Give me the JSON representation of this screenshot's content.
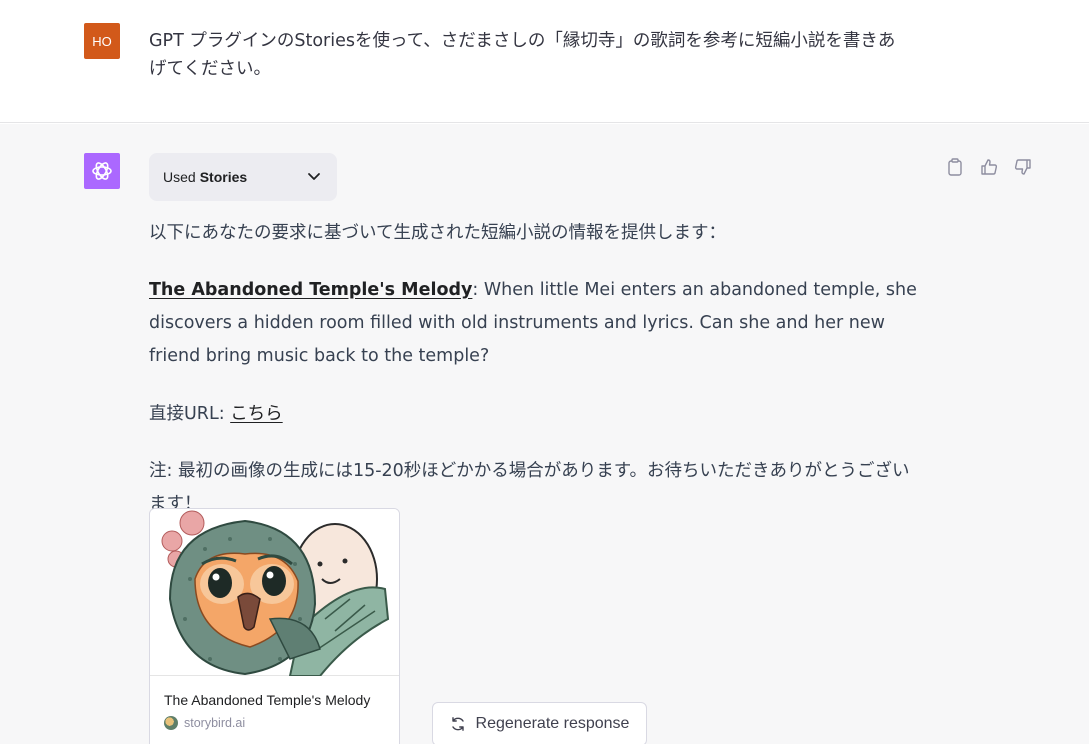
{
  "user_message": {
    "avatar_initials": "HO",
    "avatar_color": "#d2591a",
    "text": "GPT プラグインのStoriesを使って、さだまさしの「縁切寺」の歌詞を参考に短編小説を書きあげてください。"
  },
  "assistant": {
    "avatar_color": "#ab68ff",
    "avatar_icon": "openai-logo-icon",
    "plugin": {
      "used_label": "Used",
      "name": "Stories"
    },
    "actions": [
      {
        "name": "copy-icon"
      },
      {
        "name": "thumbs-up-icon"
      },
      {
        "name": "thumbs-down-icon"
      }
    ],
    "intro": "以下にあなたの要求に基づいて生成された短編小説の情報を提供します：",
    "story_title": "The Abandoned Temple's Melody",
    "story_desc": ": When little Mei enters an abandoned temple, she discovers a hidden room filled with old instruments and lyrics. Can she and her new friend bring music back to the temple?",
    "url_label": "直接URL: ",
    "url_link_text": "こちら",
    "note": "注: 最初の画像の生成には15-20秒ほどかかる場合があります。お待ちいただきありがとうございます！",
    "card": {
      "title": "The Abandoned Temple's Melody",
      "source": "storybird.ai"
    }
  },
  "regenerate_label": "Regenerate response"
}
